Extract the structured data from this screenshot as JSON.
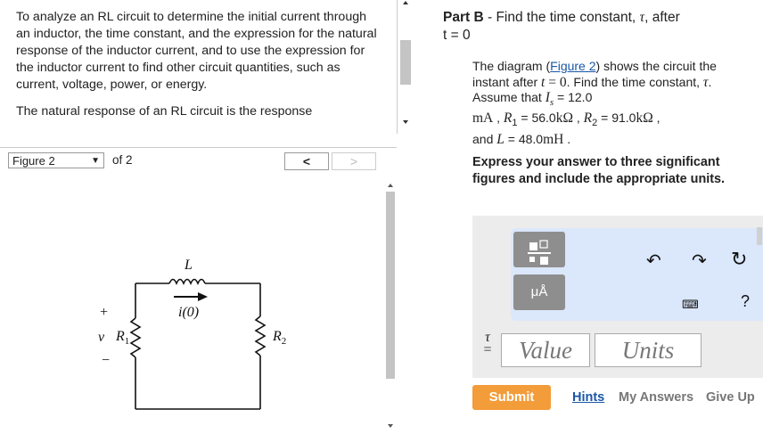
{
  "intro": {
    "paragraphs": [
      "To analyze an RL circuit to determine the initial current through an inductor, the time constant, and the expression for the natural response of the inductor current, and to use the expression for the inductor current to find other circuit quantities, such as current, voltage, power, or energy.",
      "The natural response of an RL circuit is the response"
    ]
  },
  "figure": {
    "selector_value": "Figure 2",
    "of_label": "of 2",
    "prev": "<",
    "next": ">",
    "labels": {
      "inductor": "L",
      "current": "i(0)",
      "plus": "+",
      "voltage": "v",
      "minus": "−",
      "r1": "R",
      "r1_sub": "1",
      "r2": "R",
      "r2_sub": "2"
    }
  },
  "part": {
    "label": "Part B",
    "dash": " - ",
    "title_prefix": "Find the time constant, ",
    "tau": "τ",
    "title_suffix": ", after",
    "title_line2": "t = 0"
  },
  "desc": {
    "t1": "The diagram (",
    "link": "Figure 2",
    "t2": ") shows the circuit the instant after ",
    "tvar": "t",
    "t3": " = ",
    "t0": "0",
    "t4": ". Find the time constant, ",
    "tau": "τ",
    "t5": ". Assume that ",
    "Is": "I",
    "Is_sub": "s",
    "t6": " = 12.0",
    "mA": "mA",
    "t7": " , ",
    "R1": "R",
    "R1_sub": "1",
    "t8": " = 56.0",
    "kohm1": "kΩ",
    "t9": " , ",
    "R2": "R",
    "R2_sub": "2",
    "t10": " = 91.0",
    "kohm2": "kΩ",
    "t11": " ,",
    "t12": "and ",
    "L": "L",
    "t13": " = 48.0",
    "mH": "mH",
    "t14": " ."
  },
  "instruction": "Express your answer to three significant figures and include the appropriate units.",
  "answer": {
    "units_button": "μÅ",
    "tau_label": "τ",
    "eq": "=",
    "value_placeholder": "Value",
    "units_placeholder": "Units",
    "help": "?",
    "icons": [
      "templates-icon",
      "units-icon",
      "undo-icon",
      "redo-icon",
      "reset-icon",
      "keyboard-icon",
      "help-icon"
    ]
  },
  "actions": {
    "submit": "Submit",
    "hints": "Hints",
    "my_answers": "My Answers",
    "give_up": "Give Up"
  },
  "colors": {
    "link": "#1a57a6",
    "submit": "#f39c3a",
    "toolbar": "#dbe7fb",
    "panel": "#ececec"
  }
}
